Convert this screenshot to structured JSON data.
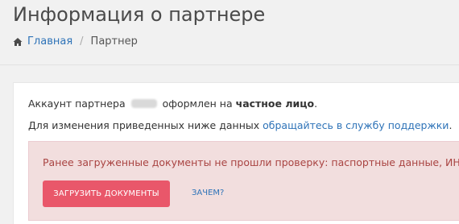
{
  "header": {
    "title": "Информация о партнере"
  },
  "breadcrumb": {
    "home_icon": "home-icon",
    "home_label": "Главная",
    "separator": "/",
    "current_label": "Партнер"
  },
  "account": {
    "prefix": "Аккаунт партнера",
    "middle": "оформлен на",
    "type": "частное лицо",
    "suffix": "."
  },
  "change_info": {
    "prefix": "Для изменения приведенных ниже данных",
    "link": "обращайтесь в службу поддержки",
    "suffix": "."
  },
  "alert": {
    "message": "Ранее загруженные документы не прошли проверку: паспортные данные, ИНН.",
    "upload_button": "ЗАГРУЗИТЬ ДОКУМЕНТЫ",
    "why_link": "ЗАЧЕМ?"
  },
  "colors": {
    "link": "#2e73b8",
    "alert_background": "#f2dede",
    "alert_text": "#a94442",
    "button": "#e9576a"
  }
}
